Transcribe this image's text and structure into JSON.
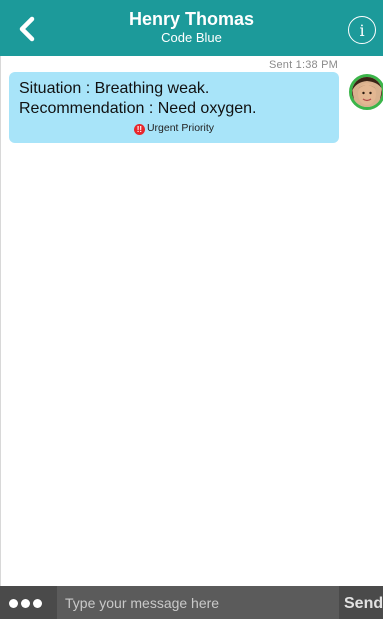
{
  "header": {
    "contact_name": "Henry Thomas",
    "subtitle": "Code Blue",
    "info_glyph": "i",
    "back_icon": "chevron-left-icon",
    "background_color": "#1c9a9a"
  },
  "messages": [
    {
      "sent_time": "Sent  1:38 PM",
      "lines": [
        "Situation : Breathing weak.",
        "Recommendation : Need oxygen."
      ],
      "priority_icon_glyph": "!!",
      "priority_label": "Urgent Priority",
      "bubble_color": "#a8e4f9",
      "avatar_ring_color": "#3bb54a"
    }
  ],
  "composer": {
    "placeholder": "Type your message here",
    "value": "",
    "send_label": "Send",
    "more_icon": "ellipsis-icon"
  }
}
